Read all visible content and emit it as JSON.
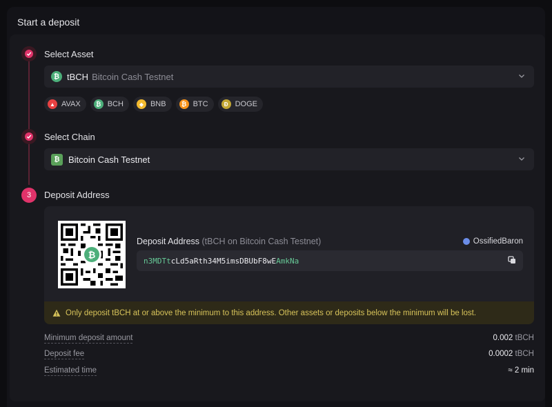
{
  "page": {
    "title": "Start a deposit"
  },
  "steps": {
    "asset": {
      "label": "Select Asset",
      "status": "done"
    },
    "chain": {
      "label": "Select Chain",
      "status": "done"
    },
    "address": {
      "label": "Deposit Address",
      "number": "3"
    }
  },
  "asset_select": {
    "symbol": "tBCH",
    "name": "Bitcoin Cash Testnet",
    "icon": "bch-coin-icon",
    "color": "#4caf7a"
  },
  "quick_assets": [
    {
      "label": "AVAX",
      "icon": "avax-icon",
      "color": "#e84142"
    },
    {
      "label": "BCH",
      "icon": "bch-icon",
      "color": "#4caf7a"
    },
    {
      "label": "BNB",
      "icon": "bnb-icon",
      "color": "#f3ba2f"
    },
    {
      "label": "BTC",
      "icon": "btc-icon",
      "color": "#f7931a"
    },
    {
      "label": "DOGE",
      "icon": "doge-icon",
      "color": "#c2a633"
    }
  ],
  "chain_select": {
    "name": "Bitcoin Cash Testnet",
    "icon": "bch-chain-icon",
    "color": "#5aa05a"
  },
  "deposit": {
    "title": "Deposit Address",
    "subtitle": "(tBCH on Bitcoin Cash Testnet)",
    "owner": "OssifiedBaron",
    "address_start": "n3MDTt",
    "address_middle": "cLd5aRth34M5imsDBUbF8wE",
    "address_end": "AmkNa",
    "warning": "Only deposit tBCH at or above the minimum to this address. Other assets or deposits below the minimum will be lost."
  },
  "info": {
    "min_label": "Minimum deposit amount",
    "min_value": "0.002",
    "min_unit": "tBCH",
    "fee_label": "Deposit fee",
    "fee_value": "0.0002",
    "fee_unit": "tBCH",
    "time_label": "Estimated time",
    "time_value": "≈ 2 min"
  },
  "colors": {
    "accent": "#e0336a",
    "warning": "#d7c35a",
    "address_highlight": "#67c997"
  }
}
